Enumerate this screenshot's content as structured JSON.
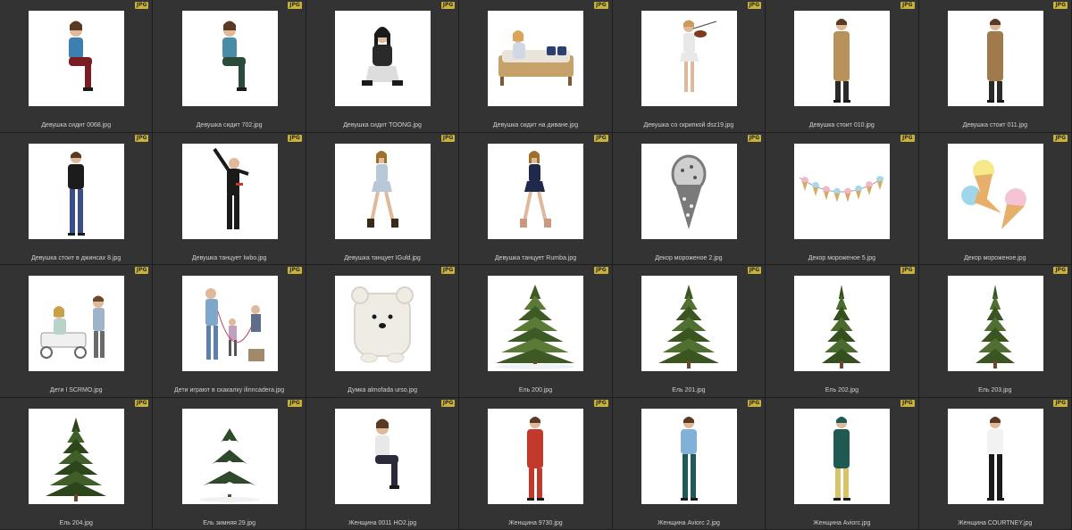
{
  "browser": {
    "badge": "JPG",
    "accent": "#c9b23a",
    "items": [
      {
        "name": "Девушка сидит 0068.jpg",
        "kind": "woman-sitting",
        "colors": [
          "#3d7fb0",
          "#7a1c22"
        ]
      },
      {
        "name": "Девушка сидит 702.jpg",
        "kind": "woman-sitting",
        "colors": [
          "#4a8ca8",
          "#2a4a3a"
        ]
      },
      {
        "name": "Девушка сидит TOONG.jpg",
        "kind": "woman-squat",
        "colors": [
          "#2a2a2a",
          "#dddddd"
        ]
      },
      {
        "name": "Девушка сидит на диване.jpg",
        "kind": "sofa",
        "colors": [
          "#c6a16a",
          "#2d3f6e"
        ]
      },
      {
        "name": "Девушка со скрипкой dsz19.jpg",
        "kind": "violin",
        "colors": [
          "#e8e8e8",
          "#7a3b1e"
        ]
      },
      {
        "name": "Девушка стоит 010.jpg",
        "kind": "woman-coat",
        "colors": [
          "#b8925a",
          "#2a2a2a"
        ]
      },
      {
        "name": "Девушка стоит 011.jpg",
        "kind": "woman-coat",
        "colors": [
          "#a07a4a",
          "#2a2a2a"
        ]
      },
      {
        "name": "Девушка стоит в джинсах 8.jpg",
        "kind": "woman-standing",
        "colors": [
          "#1c1c1c",
          "#3a4e8a"
        ]
      },
      {
        "name": "Девушка танцует Iwbo.jpg",
        "kind": "dance",
        "colors": [
          "#1a1a1a",
          "#1a1a1a"
        ]
      },
      {
        "name": "Девушка танцует IGuld.jpg",
        "kind": "dance2",
        "colors": [
          "#b8c8d8",
          "#3a2a1a"
        ]
      },
      {
        "name": "Девушка танцует Rumba.jpg",
        "kind": "dance2",
        "colors": [
          "#1f2a4a",
          "#c99a80"
        ]
      },
      {
        "name": "Декор мороженое 2.jpg",
        "kind": "icecream-one",
        "colors": [
          "#7a7a7a",
          "#cfcfcf"
        ]
      },
      {
        "name": "Декор мороженое 5.jpg",
        "kind": "garland",
        "colors": [
          "#f2b7c9",
          "#a7d8ea"
        ]
      },
      {
        "name": "Декор мороженое.jpg",
        "kind": "icecream-three",
        "colors": [
          "#f7e98a",
          "#9fd6ea"
        ]
      },
      {
        "name": "Дети I SCRMO.jpg",
        "kind": "kids-cart",
        "colors": [
          "#9fb4c8",
          "#6a6a6a"
        ]
      },
      {
        "name": "Дети играют в скакалку ilinncadera.jpg",
        "kind": "kids-rope",
        "colors": [
          "#7fa7c9",
          "#a08a6a"
        ]
      },
      {
        "name": "Думка almofada urso.jpg",
        "kind": "pillow",
        "colors": [
          "#efece4",
          "#1a1a1a"
        ]
      },
      {
        "name": "Ель 200.jpg",
        "kind": "fir-wide",
        "colors": [
          "#5b7a35",
          "#3d5a25"
        ]
      },
      {
        "name": "Ель 201.jpg",
        "kind": "fir",
        "colors": [
          "#4f7030",
          "#3a5520"
        ]
      },
      {
        "name": "Ель 202.jpg",
        "kind": "fir-tall",
        "colors": [
          "#4b6b2e",
          "#35501f"
        ]
      },
      {
        "name": "Ель 203.jpg",
        "kind": "fir-tall",
        "colors": [
          "#526f33",
          "#3a5522"
        ]
      },
      {
        "name": "Ель 204.jpg",
        "kind": "fir",
        "colors": [
          "#3f5e28",
          "#2c451a"
        ]
      },
      {
        "name": "Ель зимняя 29.jpg",
        "kind": "fir-snow",
        "colors": [
          "#2e4a2a",
          "#ffffff"
        ]
      },
      {
        "name": "Женщина 0011 HO2.jpg",
        "kind": "woman-sitting",
        "colors": [
          "#e8e8e8",
          "#2a2a3a"
        ]
      },
      {
        "name": "Женщина 9730.jpg",
        "kind": "woman-dress",
        "colors": [
          "#c0392b",
          "#2a2a2a"
        ]
      },
      {
        "name": "Женщина Aviorc 2.jpg",
        "kind": "woman-uniform",
        "colors": [
          "#7fb2d6",
          "#1f5a5a"
        ]
      },
      {
        "name": "Женщина Aviorc.jpg",
        "kind": "woman-uniform-dress",
        "colors": [
          "#1f5a52",
          "#d9c36a"
        ]
      },
      {
        "name": "Женщина COURTNEY.jpg",
        "kind": "woman-standing",
        "colors": [
          "#f2f2f2",
          "#1a1a1a"
        ]
      }
    ]
  }
}
